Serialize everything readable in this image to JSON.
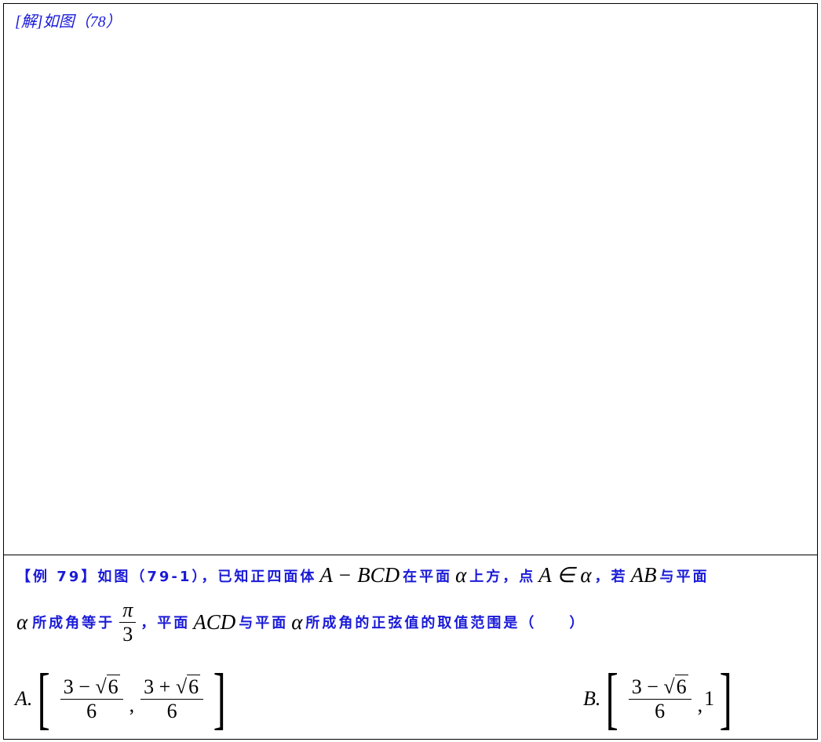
{
  "solution": {
    "label": "[解]如图（78）"
  },
  "question": {
    "tag": "【例 79】",
    "l1_a": "如图（79-1），已知正四面体",
    "l1_m1": "A − BCD",
    "l1_b": "在平面",
    "l1_m2": "α",
    "l1_c": "上方，点",
    "l1_m3": "A ∈ α",
    "l1_d": "，若",
    "l1_m4": "AB",
    "l1_e": "与平面",
    "l2_m1": "α",
    "l2_a": "所成角等于",
    "l2_frac_num": "π",
    "l2_frac_den": "3",
    "l2_b": "，平面",
    "l2_m2": "ACD",
    "l2_c": "与平面",
    "l2_m3": "α",
    "l2_d": "所成角的正弦值的取值范围是（　　）"
  },
  "options": {
    "a": {
      "letter": "A.",
      "f1_num_a": "3 − ",
      "f1_num_b": "6",
      "f1_den": "6",
      "sep": ",",
      "f2_num_a": "3 + ",
      "f2_num_b": "6",
      "f2_den": "6"
    },
    "b": {
      "letter": "B.",
      "f1_num_a": "3 − ",
      "f1_num_b": "6",
      "f1_den": "6",
      "sep": ",",
      "tail": "1"
    }
  },
  "colors": {
    "text_blue": "#1a1ad8",
    "border": "#000000"
  }
}
